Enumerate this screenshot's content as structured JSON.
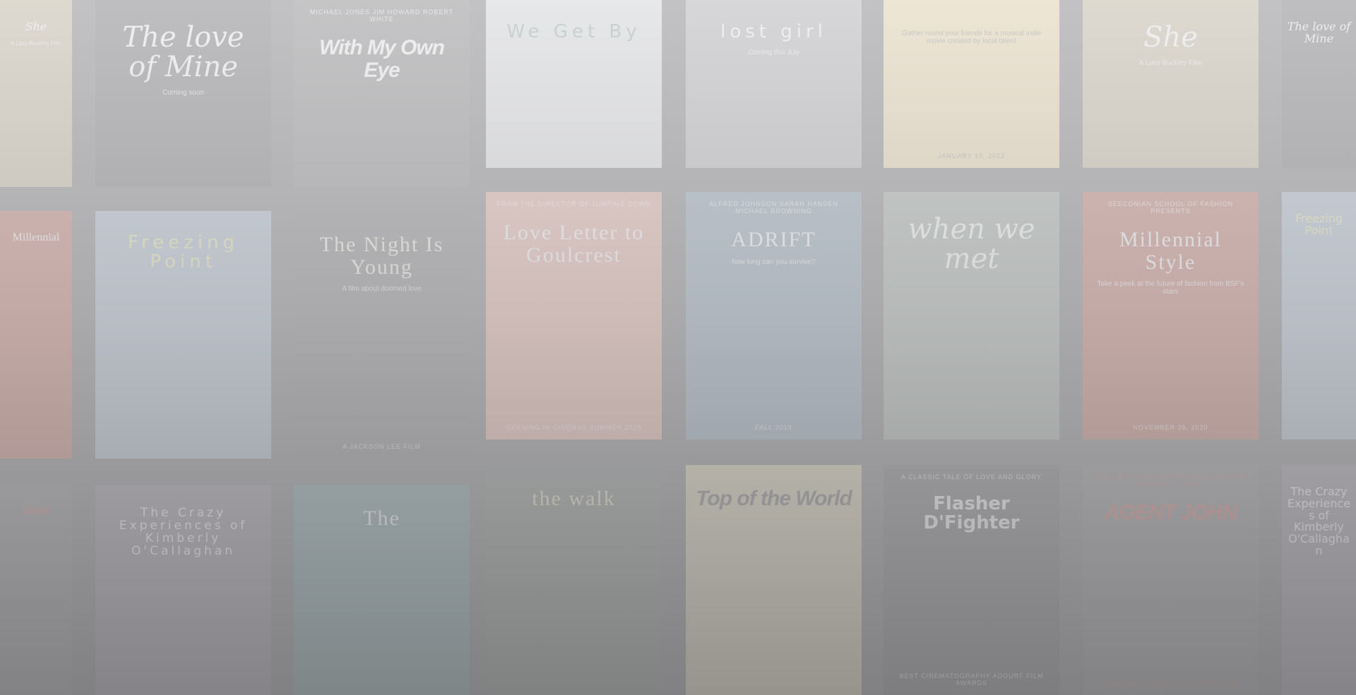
{
  "posters": [
    {
      "title": "She",
      "top": "",
      "sub": "A Lucy Buckley Film",
      "bottom": "",
      "bg": "#b5a57c",
      "fg": "#ffffff",
      "font": "f-script"
    },
    {
      "title": "Millennial",
      "top": "",
      "sub": "",
      "bottom": "",
      "bg": "#b0472e",
      "fg": "#ffffff",
      "font": "f-serif"
    },
    {
      "title": "John",
      "top": "",
      "sub": "",
      "bottom": "",
      "bg": "#555555",
      "fg": "#c0392b",
      "font": "f-cond"
    },
    {
      "title": "The love of Mine",
      "top": "",
      "sub": "Coming soon",
      "bottom": "",
      "bg": "#3c3c3e",
      "fg": "#ffffff",
      "font": "f-script"
    },
    {
      "title": "Freezing Point",
      "top": "",
      "sub": "",
      "bottom": "",
      "bg": "#8aa0b6",
      "fg": "#e6e37a",
      "font": "f-thin"
    },
    {
      "title": "The Crazy Experiences of Kimberly O'Callaghan",
      "top": "",
      "sub": "",
      "bottom": "",
      "bg": "#6b5d6b",
      "fg": "#ffffff",
      "font": "f-spaced"
    },
    {
      "title": "With My Own Eye",
      "top": "Michael Jones    Jim Howard    Robert White",
      "sub": "",
      "bottom": "",
      "bg": "#565656",
      "fg": "#ffffff",
      "font": "f-cond"
    },
    {
      "title": "The Night Is Young",
      "top": "",
      "sub": "A film about doomed love",
      "bottom": "A Jackson Lee Film",
      "bg": "#4a4a4a",
      "fg": "#f0eed8",
      "font": "f-serif"
    },
    {
      "title": "The",
      "top": "",
      "sub": "",
      "bottom": "",
      "bg": "#3f6b6d",
      "fg": "#ffffff",
      "font": "f-serif"
    },
    {
      "title": "We Get By",
      "top": "",
      "sub": "",
      "bottom": "",
      "bg": "#d9dcdb",
      "fg": "#6a8a86",
      "font": "f-thin"
    },
    {
      "title": "Love Letter to Goulcrest",
      "top": "From the director of Jumping Down",
      "sub": "",
      "bottom": "Opening in cinemas Summer 2020",
      "bg": "#e3957c",
      "fg": "#ffffff",
      "font": "f-serif"
    },
    {
      "title": "the walk",
      "top": "",
      "sub": "",
      "bottom": "",
      "bg": "#4a5048",
      "fg": "#e3d9a0",
      "font": "f-serif"
    },
    {
      "title": "lost girl",
      "top": "",
      "sub": "Coming this July",
      "bottom": "",
      "bg": "#9a9a9c",
      "fg": "#ffffff",
      "font": "f-thin"
    },
    {
      "title": "ADRIFT",
      "top": "Alfred Johnson    Sarah Hansen    Michael Browning",
      "sub": "how long can you survive?",
      "bottom": "Fall 2019",
      "bg": "#5f7d93",
      "fg": "#ffffff",
      "font": "f-serif"
    },
    {
      "title": "Top of the World",
      "top": "",
      "sub": "",
      "bottom": "",
      "bg": "#c8b98a",
      "fg": "#3a3a3a",
      "font": "f-cond"
    },
    {
      "title": "",
      "top": "",
      "sub": "Gather round your friends for a musical indie movie created by local talent",
      "bottom": "January 10, 2022",
      "bg": "#f0d38c",
      "fg": "#555555",
      "font": "f-bold"
    },
    {
      "title": "when we met",
      "top": "",
      "sub": "",
      "bottom": "",
      "bg": "#7c8a7b",
      "fg": "#ffffff",
      "font": "f-script"
    },
    {
      "title": "Flasher D'Fighter",
      "top": "A classic tale of love and glory",
      "sub": "",
      "bottom": "Best Cinematography Adourf Film Awards",
      "bg": "#3a3a3c",
      "fg": "#ffffff",
      "font": "f-bold"
    },
    {
      "title": "She",
      "top": "",
      "sub": "A Lucy Buckley Film",
      "bottom": "",
      "bg": "#b5a57c",
      "fg": "#ffffff",
      "font": "f-script"
    },
    {
      "title": "Millennial Style",
      "top": "Seeconian School of Fashion presents",
      "sub": "Take a peek at the future of fashion from BSF's stars",
      "bottom": "November 28, 2020",
      "bg": "#b0472e",
      "fg": "#ffffff",
      "font": "f-serif"
    },
    {
      "title": "AGENT JOHN",
      "top": "The first film written and directed by Marley Wanj",
      "sub": "",
      "bottom": "Mark De Guzman    Henry Ruffalo",
      "bg": "#555555",
      "fg": "#c0392b",
      "font": "f-cond"
    },
    {
      "title": "The love of Mine",
      "top": "",
      "sub": "",
      "bottom": "",
      "bg": "#3c3c3e",
      "fg": "#ffffff",
      "font": "f-script"
    },
    {
      "title": "Freezing Point",
      "top": "",
      "sub": "",
      "bottom": "",
      "bg": "#8aa0b6",
      "fg": "#e6e37a",
      "font": "f-thin"
    },
    {
      "title": "The Crazy Experiences of Kimberly O'Callaghan",
      "top": "",
      "sub": "",
      "bottom": "",
      "bg": "#6b5d6b",
      "fg": "#ffffff",
      "font": "f-spaced"
    }
  ]
}
